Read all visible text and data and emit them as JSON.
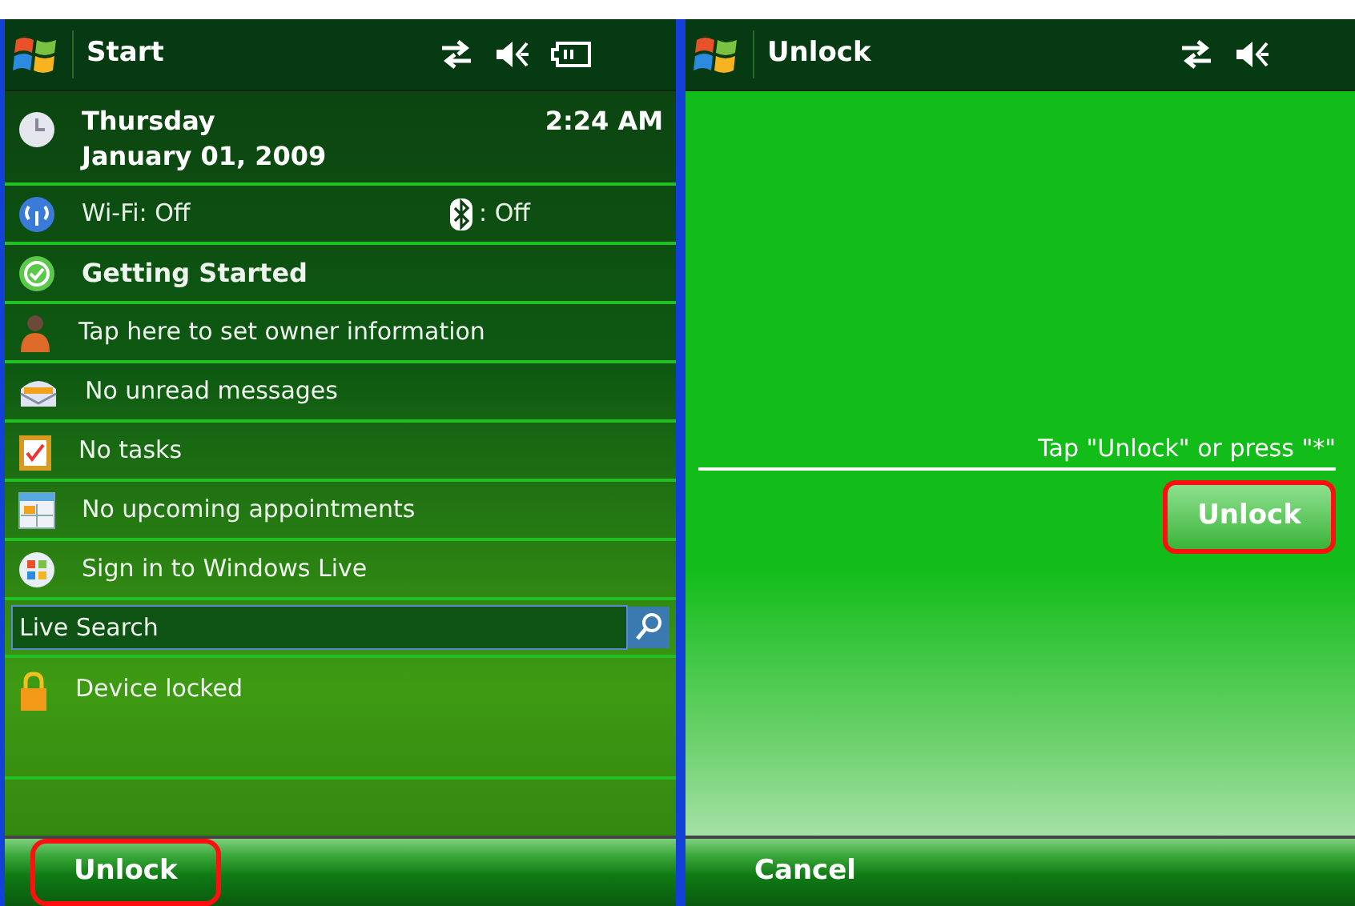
{
  "left_screen": {
    "title_bar": {
      "title": "Start",
      "status_icons": [
        {
          "kind": "sync"
        },
        {
          "kind": "volume"
        },
        {
          "kind": "battery"
        }
      ]
    },
    "today": {
      "day": "Thursday",
      "date": "January 01, 2009",
      "time": "2:24 AM"
    },
    "wireless": {
      "wifi": "Wi-Fi: Off",
      "bluetooth": ": Off"
    },
    "items": [
      {
        "label": "Getting Started",
        "bold": true,
        "kind": "getting-started"
      },
      {
        "label": "Tap here to set owner information",
        "bold": false,
        "kind": "owner"
      },
      {
        "label": "No unread messages",
        "bold": false,
        "kind": "messages"
      },
      {
        "label": "No tasks",
        "bold": false,
        "kind": "tasks"
      },
      {
        "label": "No upcoming appointments",
        "bold": false,
        "kind": "calendar"
      },
      {
        "label": "Sign in to Windows Live",
        "bold": false,
        "kind": "live"
      }
    ],
    "search": {
      "placeholder": "Live Search"
    },
    "lock_item": {
      "label": "Device locked"
    },
    "soft_key": {
      "label": "Unlock",
      "highlighted": true
    }
  },
  "right_screen": {
    "title_bar": {
      "title": "Unlock",
      "status_icons": [
        {
          "kind": "sync"
        },
        {
          "kind": "volume"
        }
      ]
    },
    "instruction": "Tap \"Unlock\" or press \"*\"",
    "unlock_button": {
      "label": "Unlock",
      "highlighted": true
    },
    "soft_key": {
      "label": "Cancel",
      "highlighted": false
    }
  }
}
